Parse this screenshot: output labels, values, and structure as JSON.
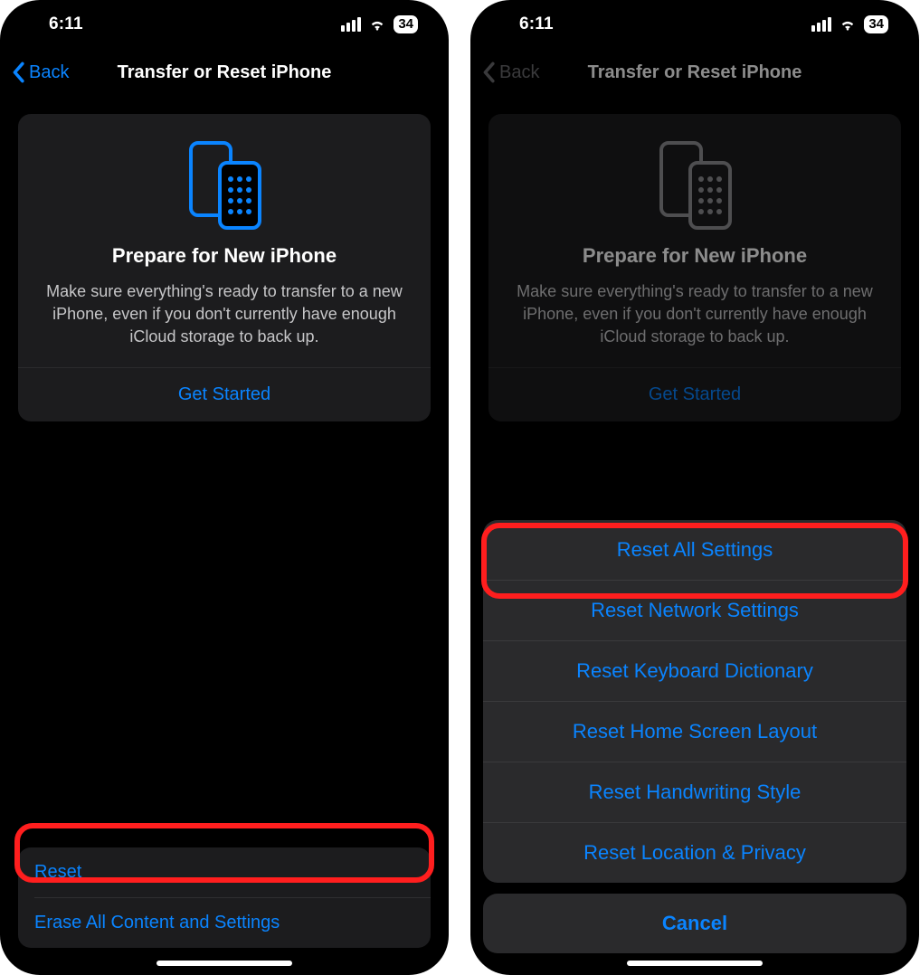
{
  "status": {
    "time": "6:11",
    "battery_percent": "34"
  },
  "left": {
    "nav": {
      "back": "Back",
      "title": "Transfer or Reset iPhone"
    },
    "card": {
      "title": "Prepare for New iPhone",
      "desc": "Make sure everything's ready to transfer to a new iPhone, even if you don't currently have enough iCloud storage to back up.",
      "action": "Get Started"
    },
    "rows": {
      "reset": "Reset",
      "erase": "Erase All Content and Settings"
    }
  },
  "right": {
    "nav": {
      "back": "Back",
      "title": "Transfer or Reset iPhone"
    },
    "card": {
      "title": "Prepare for New iPhone",
      "desc": "Make sure everything's ready to transfer to a new iPhone, even if you don't currently have enough iCloud storage to back up.",
      "action": "Get Started"
    },
    "sheet": {
      "all": "Reset All Settings",
      "network": "Reset Network Settings",
      "keyboard": "Reset Keyboard Dictionary",
      "home": "Reset Home Screen Layout",
      "handwriting": "Reset Handwriting Style",
      "location": "Reset Location & Privacy",
      "cancel": "Cancel"
    }
  },
  "colors": {
    "accent": "#0a84ff",
    "highlight": "#ff1e1e"
  }
}
